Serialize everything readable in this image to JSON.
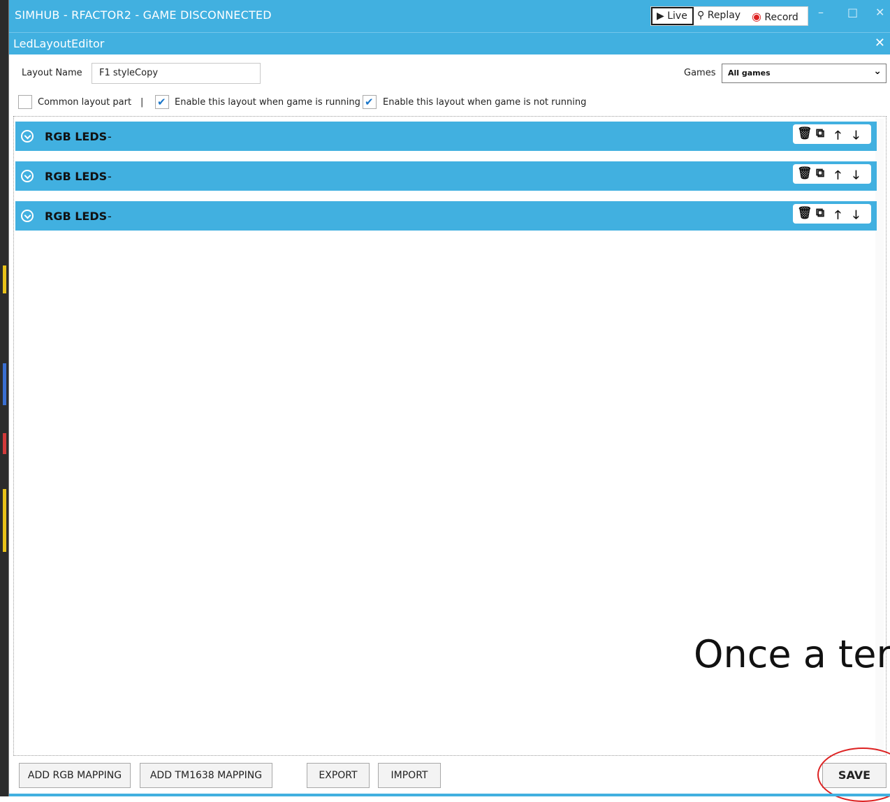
{
  "window": {
    "app_title": "SIMHUB - RFACTOR2 - GAME DISCONNECTED",
    "modes": {
      "live": "Live",
      "replay": "Replay",
      "record": "Record"
    },
    "min_glyph": "–",
    "max_glyph": "□",
    "close_glyph": "✕"
  },
  "dialog": {
    "title": "LedLayoutEditor",
    "close_glyph": "✕"
  },
  "form": {
    "layout_name_label": "Layout Name",
    "layout_name_value": "F1 styleCopy",
    "games_label": "Games",
    "games_value": "All games"
  },
  "options": {
    "common_part_label": "Common layout part",
    "separator": "|",
    "enable_running_label": "Enable this layout when game is running",
    "enable_not_running_label": "Enable this layout when game is not running"
  },
  "sections": [
    {
      "title": "RGB LEDS",
      "suffix": "-"
    },
    {
      "title": "RGB LEDS",
      "suffix": "-"
    },
    {
      "title": "RGB LEDS",
      "suffix": "-"
    }
  ],
  "tool_icons": [
    "trash-icon",
    "copy-icon",
    "arrow-up-icon",
    "arrow-down-icon"
  ],
  "overlay_text": "Once a ter",
  "buttons": {
    "add_rgb": "ADD RGB MAPPING",
    "add_tm1638": "ADD TM1638 MAPPING",
    "export": "EXPORT",
    "import": "IMPORT",
    "save": "SAVE"
  },
  "colors": {
    "accent": "#41b0e0",
    "checkmark": "#1b76c9",
    "annotation": "#dd2222"
  }
}
